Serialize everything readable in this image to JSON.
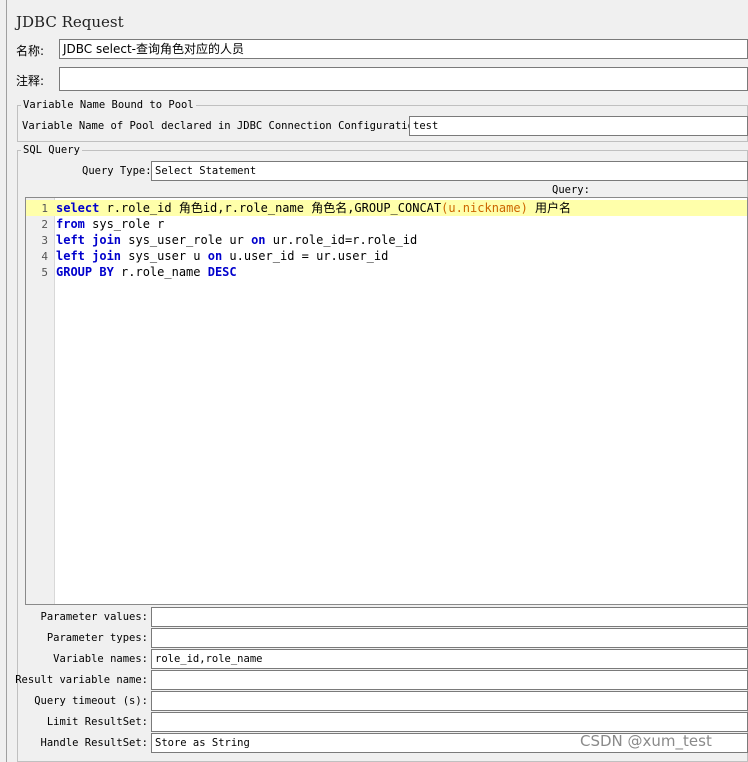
{
  "panel": {
    "title": "JDBC Request",
    "name_label": "名称:",
    "name_value": "JDBC select-查询角色对应的人员",
    "comment_label": "注释:",
    "comment_value": ""
  },
  "pool_group": {
    "title": "Variable Name Bound to Pool",
    "label": "Variable Name of Pool declared in JDBC Connection Configuration:",
    "value": "test"
  },
  "sql_group": {
    "title": "SQL Query",
    "query_type_label": "Query Type:",
    "query_type_value": "Select Statement",
    "query_label": "Query:",
    "lines": [
      {
        "n": "1",
        "parts": [
          {
            "t": "select",
            "c": "kw"
          },
          {
            "t": " r.role_id 角色id,r.role_name 角色名,GROUP_CONCAT",
            "c": "tx"
          },
          {
            "t": "(u.nickname)",
            "c": "fn"
          },
          {
            "t": " 用户名",
            "c": "tx"
          }
        ]
      },
      {
        "n": "2",
        "parts": [
          {
            "t": "from",
            "c": "kw"
          },
          {
            "t": " sys_role r",
            "c": "tx"
          }
        ]
      },
      {
        "n": "3",
        "parts": [
          {
            "t": "left join",
            "c": "kw"
          },
          {
            "t": " sys_user_role ur ",
            "c": "tx"
          },
          {
            "t": "on",
            "c": "kw"
          },
          {
            "t": " ur.role_id=r.role_id",
            "c": "tx"
          }
        ]
      },
      {
        "n": "4",
        "parts": [
          {
            "t": "left join",
            "c": "kw"
          },
          {
            "t": " sys_user u ",
            "c": "tx"
          },
          {
            "t": "on",
            "c": "kw"
          },
          {
            "t": " u.user_id = ur.user_id",
            "c": "tx"
          }
        ]
      },
      {
        "n": "5",
        "parts": [
          {
            "t": "GROUP BY",
            "c": "kw"
          },
          {
            "t": " r.role_name ",
            "c": "tx"
          },
          {
            "t": "DESC",
            "c": "kw"
          }
        ]
      }
    ]
  },
  "params": [
    {
      "label": "Parameter values:",
      "value": ""
    },
    {
      "label": "Parameter types:",
      "value": ""
    },
    {
      "label": "Variable names:",
      "value": "role_id,role_name"
    },
    {
      "label": "Result variable name:",
      "value": ""
    },
    {
      "label": "Query timeout (s):",
      "value": ""
    },
    {
      "label": "Limit ResultSet:",
      "value": ""
    },
    {
      "label": "Handle ResultSet:",
      "value": "Store as String"
    }
  ],
  "watermark": "CSDN @xum_test"
}
